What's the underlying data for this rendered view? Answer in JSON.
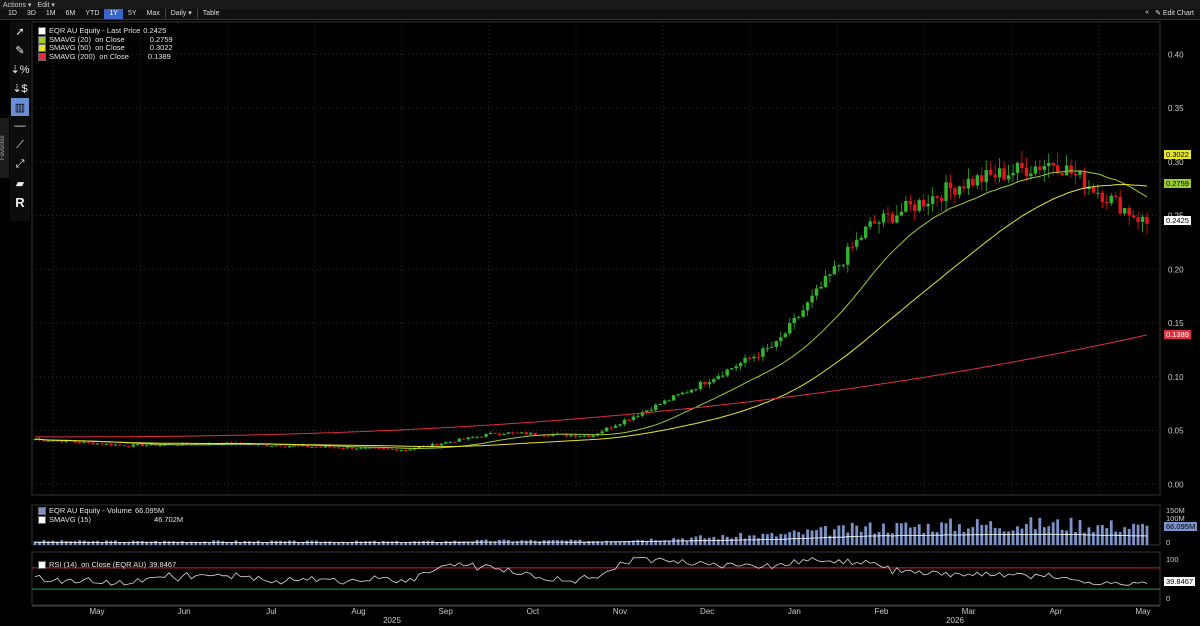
{
  "menubar": {
    "actions": "Actions ▾",
    "edit": "Edit ▾"
  },
  "toolbar": {
    "periods": [
      "1D",
      "3D",
      "1M",
      "6M",
      "YTD",
      "1Y",
      "5Y",
      "Max"
    ],
    "active_period": "1Y",
    "frequency": "Daily ▾",
    "table": "Table",
    "edit_chart": "✎ Edit Chart",
    "collapse": "«"
  },
  "sidebar": {
    "favorites_label": "Favorites",
    "tools": [
      "arrow-icon",
      "pencil-icon",
      "percent-zoom-icon",
      "dollar-zoom-icon",
      "bar-icon",
      "line-icon",
      "trend-icon",
      "trend-alt-icon",
      "channel-icon",
      "r-icon"
    ]
  },
  "colors": {
    "up": "#33b52e",
    "down": "#e8141a",
    "sma20": "#9acd32",
    "sma50": "#e6e62a",
    "sma200": "#e03040",
    "volume": "#7b93c8",
    "rsi": "#dddddd",
    "rsi_upper": "#d62020",
    "rsi_lower": "#1fa13a"
  },
  "legend_price": [
    {
      "label": "EQR AU Equity - Last Price",
      "value": "0.2425",
      "color": "#ffffff"
    },
    {
      "label": "SMAVG (20)  on Close",
      "value": "0.2759",
      "color": "#9acd32"
    },
    {
      "label": "SMAVG (50)  on Close",
      "value": "0.3022",
      "color": "#e6e62a"
    },
    {
      "label": "SMAVG (200)  on Close",
      "value": "0.1389",
      "color": "#e03040"
    }
  ],
  "legend_volume": [
    {
      "label": "EQR AU Equity - Volume",
      "value": "66.095M",
      "color": "#7b93c8"
    },
    {
      "label": "SMAVG (15)",
      "value": "46.702M",
      "color": "#ffffff"
    }
  ],
  "legend_rsi": [
    {
      "label": "RSI (14)  on Close (EQR AU)",
      "value": "39.8467",
      "color": "#ffffff"
    }
  ],
  "price_tags": [
    {
      "value": "0.3022",
      "bg": "#e6e62a",
      "fg": "#000"
    },
    {
      "value": "0.2759",
      "bg": "#9acd32",
      "fg": "#000"
    },
    {
      "value": "0.2425",
      "bg": "#ffffff",
      "fg": "#000"
    },
    {
      "value": "0.1389",
      "bg": "#e03040",
      "fg": "#fff"
    }
  ],
  "volume_tags": [
    "150M",
    "100M",
    "66.095M",
    "0"
  ],
  "rsi_tags": [
    "100",
    "39.8467",
    "0"
  ],
  "x_month_labels": [
    "May",
    "Jun",
    "Jul",
    "Aug",
    "Sep",
    "Oct",
    "Nov",
    "Dec",
    "Jan",
    "Feb",
    "Mar",
    "Apr",
    "May"
  ],
  "x_year_labels": [
    "2025",
    "2026"
  ],
  "chart_data": {
    "type": "candlestick",
    "price_axis": {
      "ticks": [
        0.0,
        0.05,
        0.1,
        0.15,
        0.2,
        0.25,
        0.3,
        0.35,
        0.4
      ],
      "tick_labels": [
        "0.00",
        "0.05",
        "0.10",
        "0.15",
        "0.20",
        "0.25",
        "0.30",
        "0.35",
        "0.40"
      ],
      "ylim": [
        -0.01,
        0.43
      ]
    },
    "volume_axis": {
      "ticks": [
        0,
        100,
        150
      ],
      "tick_labels": [
        "0",
        "100M",
        "150M"
      ],
      "ylim": [
        0,
        170
      ]
    },
    "rsi_axis": {
      "ticks": [
        0,
        100
      ],
      "tick_labels": [
        "0",
        "100"
      ],
      "upper": 70,
      "lower": 30,
      "ylim": [
        0,
        100
      ]
    },
    "months": [
      "May",
      "Jun",
      "Jul",
      "Aug",
      "Sep",
      "Oct",
      "Nov",
      "Dec",
      "Jan",
      "Feb",
      "Mar",
      "Apr",
      "May"
    ],
    "close_by_month": [
      0.042,
      0.036,
      0.038,
      0.035,
      0.032,
      0.048,
      0.045,
      0.085,
      0.13,
      0.24,
      0.28,
      0.3,
      0.2425
    ],
    "sma20_last": 0.2759,
    "sma50_last": 0.3022,
    "sma200_last": 0.1389,
    "last_price": 0.2425,
    "last_volume_m": 66.095,
    "vol_sma15_m": 46.702,
    "rsi_last": 39.8467,
    "grid": true
  }
}
